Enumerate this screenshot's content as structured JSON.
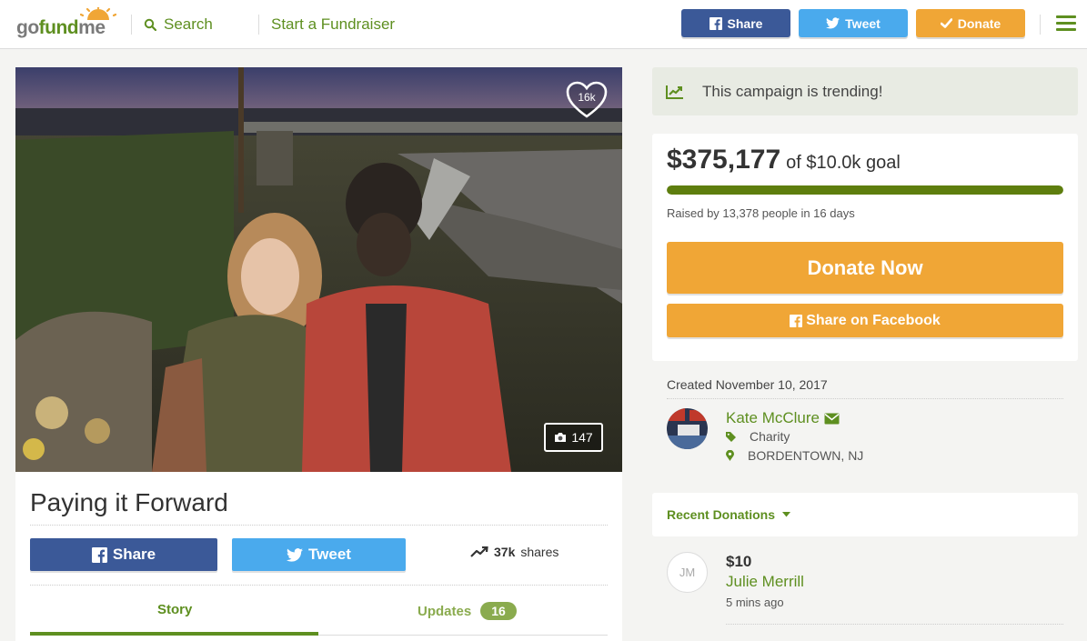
{
  "brand": {
    "logo": {
      "go": "go",
      "fund": "fund",
      "me": "me"
    },
    "accent_green": "#5e8f20",
    "orange": "#f0a636",
    "facebook_blue": "#3b5998",
    "twitter_blue": "#4aaaed"
  },
  "header": {
    "search_label": "Search",
    "start_label": "Start a Fundraiser",
    "share_label": "Share",
    "tweet_label": "Tweet",
    "donate_label": "Donate"
  },
  "campaign": {
    "hearts": "16k",
    "photo_count": "147",
    "title": "Paying it Forward",
    "share_label": "Share",
    "tweet_label": "Tweet",
    "shares_count": "37k",
    "shares_label": "shares",
    "tabs": {
      "story": "Story",
      "updates": "Updates",
      "updates_count": "16"
    }
  },
  "sidebar": {
    "trending_text": "This campaign is trending!",
    "raised_amount": "$375,177",
    "goal_text": "of $10.0k goal",
    "progress_fraction": 1.0,
    "raised_by": "Raised by 13,378 people in 16 days",
    "donate_now": "Donate Now",
    "share_facebook": "Share on Facebook",
    "created": "Created November 10, 2017",
    "organizer": {
      "name": "Kate McClure",
      "category": "Charity",
      "location": "BORDENTOWN, NJ"
    },
    "recent_title": "Recent Donations",
    "donations": [
      {
        "initials": "JM",
        "amount": "$10",
        "name": "Julie Merrill",
        "time": "5 mins ago"
      }
    ]
  }
}
